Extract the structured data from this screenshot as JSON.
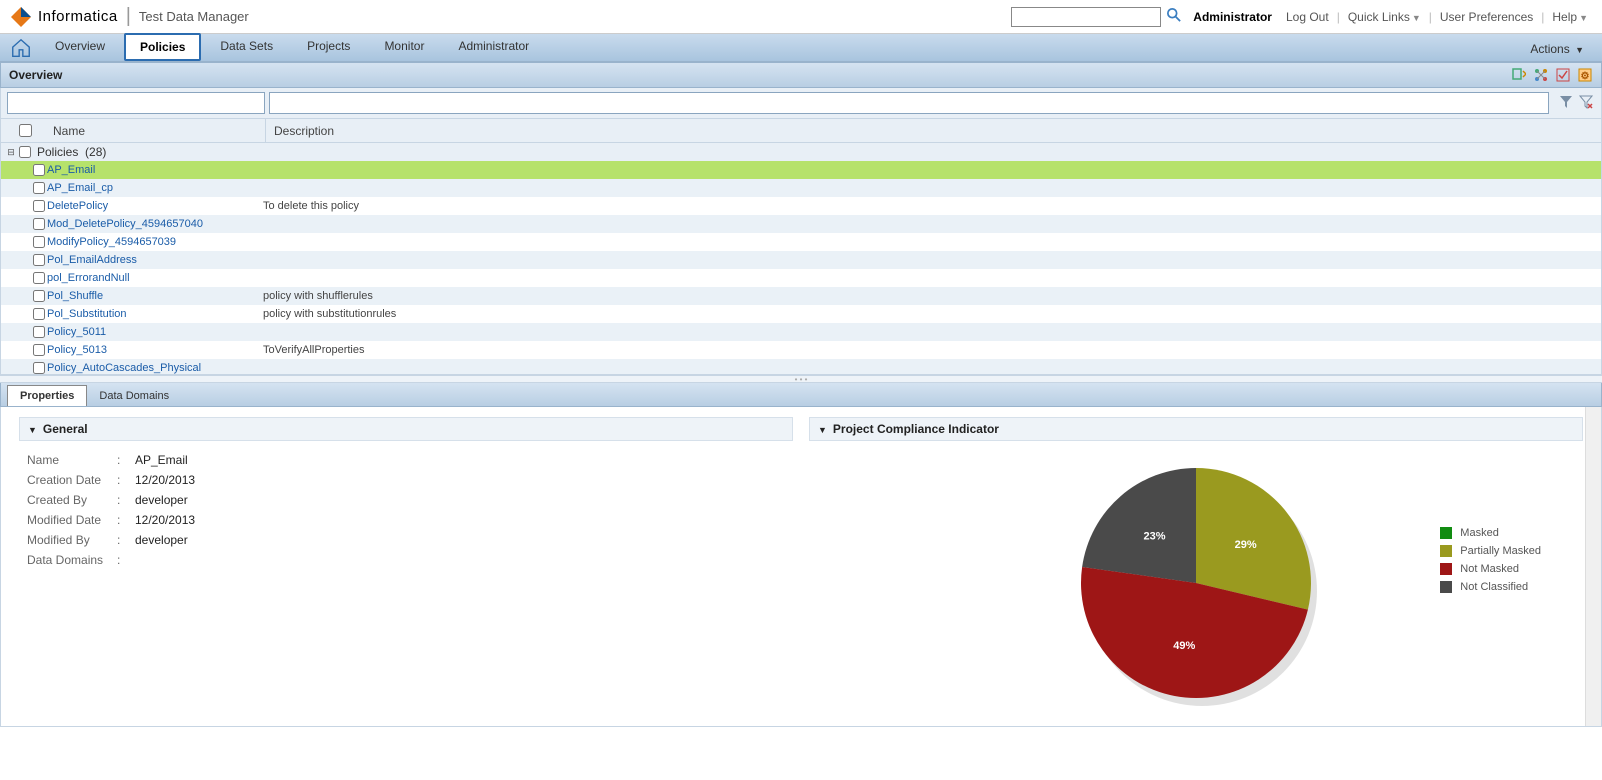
{
  "header": {
    "brand": "Informatica",
    "app_title": "Test Data Manager",
    "user": "Administrator",
    "links": {
      "logout": "Log Out",
      "quick_links": "Quick Links",
      "prefs": "User Preferences",
      "help": "Help"
    }
  },
  "nav": {
    "tabs": [
      "Overview",
      "Policies",
      "Data Sets",
      "Projects",
      "Monitor",
      "Administrator"
    ],
    "active": "Policies",
    "actions": "Actions"
  },
  "section": {
    "title": "Overview"
  },
  "table": {
    "headers": {
      "name": "Name",
      "desc": "Description"
    },
    "group": {
      "label": "Policies",
      "count": 28
    },
    "rows": [
      {
        "name": "AP_Email",
        "desc": "",
        "selected": true
      },
      {
        "name": "AP_Email_cp",
        "desc": ""
      },
      {
        "name": "DeletePolicy",
        "desc": "To delete this policy"
      },
      {
        "name": "Mod_DeletePolicy_4594657040",
        "desc": ""
      },
      {
        "name": "ModifyPolicy_4594657039",
        "desc": ""
      },
      {
        "name": "Pol_EmailAddress",
        "desc": ""
      },
      {
        "name": "pol_ErrorandNull",
        "desc": ""
      },
      {
        "name": "Pol_Shuffle",
        "desc": "policy with shufflerules"
      },
      {
        "name": "Pol_Substitution",
        "desc": "policy with substitutionrules"
      },
      {
        "name": "Policy_5011",
        "desc": ""
      },
      {
        "name": "Policy_5013",
        "desc": "ToVerifyAllProperties"
      },
      {
        "name": "Policy_AutoCascades_Physical",
        "desc": ""
      }
    ]
  },
  "detail_tabs": {
    "properties": "Properties",
    "data_domains": "Data Domains"
  },
  "general": {
    "title": "General",
    "rows": [
      {
        "label": "Name",
        "value": "AP_Email"
      },
      {
        "label": "Creation Date",
        "value": "12/20/2013"
      },
      {
        "label": "Created By",
        "value": "developer"
      },
      {
        "label": "Modified Date",
        "value": "12/20/2013"
      },
      {
        "label": "Modified By",
        "value": "developer"
      },
      {
        "label": "Data Domains",
        "value": ""
      }
    ]
  },
  "compliance": {
    "title": "Project Compliance Indicator",
    "legend": [
      {
        "label": "Masked",
        "color": "#118c11"
      },
      {
        "label": "Partially Masked",
        "color": "#9a9a1f"
      },
      {
        "label": "Not Masked",
        "color": "#9e1616"
      },
      {
        "label": "Not Classified",
        "color": "#4a4a4a"
      }
    ]
  },
  "chart_data": {
    "type": "pie",
    "title": "Project Compliance Indicator",
    "series": [
      {
        "name": "Masked",
        "value": 0,
        "color": "#118c11",
        "label": ""
      },
      {
        "name": "Partially Masked",
        "value": 29,
        "color": "#9a9a1f",
        "label": "29%"
      },
      {
        "name": "Not Masked",
        "value": 49,
        "color": "#9e1616",
        "label": "49%"
      },
      {
        "name": "Not Classified",
        "value": 23,
        "color": "#4a4a4a",
        "label": "23%"
      }
    ]
  }
}
